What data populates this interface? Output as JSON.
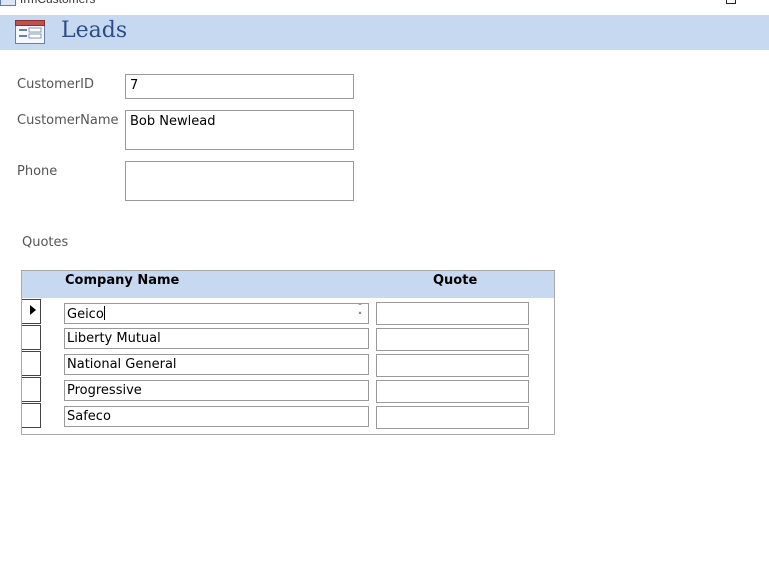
{
  "window": {
    "tab_title": "frmCustomers"
  },
  "header": {
    "title": "Leads"
  },
  "fields": [
    {
      "label": "CustomerID",
      "value": "7"
    },
    {
      "label": "CustomerName",
      "value": "Bob Newlead"
    },
    {
      "label": "Phone",
      "value": ""
    }
  ],
  "quotes": {
    "label": "Quotes",
    "columns": {
      "company": "Company Name",
      "quote": "Quote"
    },
    "rows": [
      {
        "company": "Geico",
        "quote": ""
      },
      {
        "company": "Liberty Mutual",
        "quote": ""
      },
      {
        "company": "National General",
        "quote": ""
      },
      {
        "company": "Progressive",
        "quote": ""
      },
      {
        "company": "Safeco",
        "quote": ""
      }
    ]
  },
  "colors": {
    "header_band": "#c6d9f1",
    "title": "#2c4e84"
  }
}
